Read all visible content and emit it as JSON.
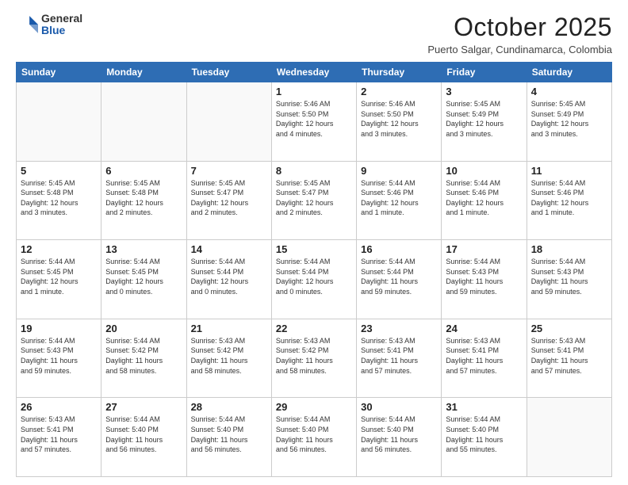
{
  "logo": {
    "general": "General",
    "blue": "Blue"
  },
  "header": {
    "title": "October 2025",
    "subtitle": "Puerto Salgar, Cundinamarca, Colombia"
  },
  "weekdays": [
    "Sunday",
    "Monday",
    "Tuesday",
    "Wednesday",
    "Thursday",
    "Friday",
    "Saturday"
  ],
  "weeks": [
    [
      {
        "day": "",
        "info": ""
      },
      {
        "day": "",
        "info": ""
      },
      {
        "day": "",
        "info": ""
      },
      {
        "day": "1",
        "info": "Sunrise: 5:46 AM\nSunset: 5:50 PM\nDaylight: 12 hours\nand 4 minutes."
      },
      {
        "day": "2",
        "info": "Sunrise: 5:46 AM\nSunset: 5:50 PM\nDaylight: 12 hours\nand 3 minutes."
      },
      {
        "day": "3",
        "info": "Sunrise: 5:45 AM\nSunset: 5:49 PM\nDaylight: 12 hours\nand 3 minutes."
      },
      {
        "day": "4",
        "info": "Sunrise: 5:45 AM\nSunset: 5:49 PM\nDaylight: 12 hours\nand 3 minutes."
      }
    ],
    [
      {
        "day": "5",
        "info": "Sunrise: 5:45 AM\nSunset: 5:48 PM\nDaylight: 12 hours\nand 3 minutes."
      },
      {
        "day": "6",
        "info": "Sunrise: 5:45 AM\nSunset: 5:48 PM\nDaylight: 12 hours\nand 2 minutes."
      },
      {
        "day": "7",
        "info": "Sunrise: 5:45 AM\nSunset: 5:47 PM\nDaylight: 12 hours\nand 2 minutes."
      },
      {
        "day": "8",
        "info": "Sunrise: 5:45 AM\nSunset: 5:47 PM\nDaylight: 12 hours\nand 2 minutes."
      },
      {
        "day": "9",
        "info": "Sunrise: 5:44 AM\nSunset: 5:46 PM\nDaylight: 12 hours\nand 1 minute."
      },
      {
        "day": "10",
        "info": "Sunrise: 5:44 AM\nSunset: 5:46 PM\nDaylight: 12 hours\nand 1 minute."
      },
      {
        "day": "11",
        "info": "Sunrise: 5:44 AM\nSunset: 5:46 PM\nDaylight: 12 hours\nand 1 minute."
      }
    ],
    [
      {
        "day": "12",
        "info": "Sunrise: 5:44 AM\nSunset: 5:45 PM\nDaylight: 12 hours\nand 1 minute."
      },
      {
        "day": "13",
        "info": "Sunrise: 5:44 AM\nSunset: 5:45 PM\nDaylight: 12 hours\nand 0 minutes."
      },
      {
        "day": "14",
        "info": "Sunrise: 5:44 AM\nSunset: 5:44 PM\nDaylight: 12 hours\nand 0 minutes."
      },
      {
        "day": "15",
        "info": "Sunrise: 5:44 AM\nSunset: 5:44 PM\nDaylight: 12 hours\nand 0 minutes."
      },
      {
        "day": "16",
        "info": "Sunrise: 5:44 AM\nSunset: 5:44 PM\nDaylight: 11 hours\nand 59 minutes."
      },
      {
        "day": "17",
        "info": "Sunrise: 5:44 AM\nSunset: 5:43 PM\nDaylight: 11 hours\nand 59 minutes."
      },
      {
        "day": "18",
        "info": "Sunrise: 5:44 AM\nSunset: 5:43 PM\nDaylight: 11 hours\nand 59 minutes."
      }
    ],
    [
      {
        "day": "19",
        "info": "Sunrise: 5:44 AM\nSunset: 5:43 PM\nDaylight: 11 hours\nand 59 minutes."
      },
      {
        "day": "20",
        "info": "Sunrise: 5:44 AM\nSunset: 5:42 PM\nDaylight: 11 hours\nand 58 minutes."
      },
      {
        "day": "21",
        "info": "Sunrise: 5:43 AM\nSunset: 5:42 PM\nDaylight: 11 hours\nand 58 minutes."
      },
      {
        "day": "22",
        "info": "Sunrise: 5:43 AM\nSunset: 5:42 PM\nDaylight: 11 hours\nand 58 minutes."
      },
      {
        "day": "23",
        "info": "Sunrise: 5:43 AM\nSunset: 5:41 PM\nDaylight: 11 hours\nand 57 minutes."
      },
      {
        "day": "24",
        "info": "Sunrise: 5:43 AM\nSunset: 5:41 PM\nDaylight: 11 hours\nand 57 minutes."
      },
      {
        "day": "25",
        "info": "Sunrise: 5:43 AM\nSunset: 5:41 PM\nDaylight: 11 hours\nand 57 minutes."
      }
    ],
    [
      {
        "day": "26",
        "info": "Sunrise: 5:43 AM\nSunset: 5:41 PM\nDaylight: 11 hours\nand 57 minutes."
      },
      {
        "day": "27",
        "info": "Sunrise: 5:44 AM\nSunset: 5:40 PM\nDaylight: 11 hours\nand 56 minutes."
      },
      {
        "day": "28",
        "info": "Sunrise: 5:44 AM\nSunset: 5:40 PM\nDaylight: 11 hours\nand 56 minutes."
      },
      {
        "day": "29",
        "info": "Sunrise: 5:44 AM\nSunset: 5:40 PM\nDaylight: 11 hours\nand 56 minutes."
      },
      {
        "day": "30",
        "info": "Sunrise: 5:44 AM\nSunset: 5:40 PM\nDaylight: 11 hours\nand 56 minutes."
      },
      {
        "day": "31",
        "info": "Sunrise: 5:44 AM\nSunset: 5:40 PM\nDaylight: 11 hours\nand 55 minutes."
      },
      {
        "day": "",
        "info": ""
      }
    ]
  ]
}
